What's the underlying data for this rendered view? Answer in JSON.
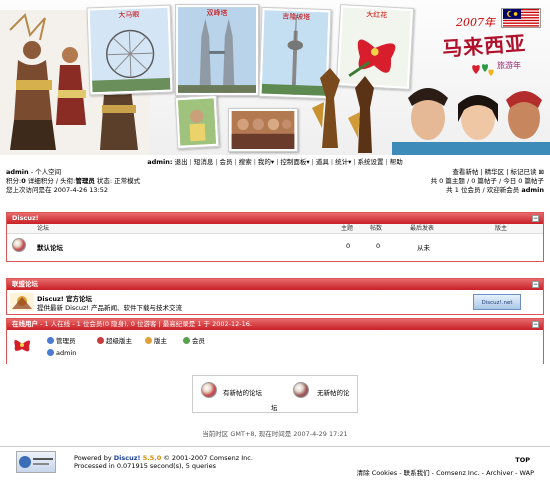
{
  "banner": {
    "photo_captions": [
      "大马眼",
      "双峰塔",
      "吉隆坡塔",
      "大红花"
    ],
    "logo_year": "2007年",
    "logo_title": "马来西亚",
    "logo_sub": "旅游年"
  },
  "nav": {
    "user": "admin:",
    "items": [
      "退出",
      "短消息",
      "会员",
      "搜索",
      "我的▾",
      "控制面板▾",
      "道具",
      "统计▾",
      "系统设置",
      "帮助"
    ]
  },
  "userinfo": {
    "line1_user": "admin",
    "line1_rest": " - 个人空间",
    "line2_a": "积分:",
    "line2_points": "0",
    "line2_b": " 详细积分 / 头衔:",
    "line2_title": "管理员",
    "line2_c": " 状态: 正常模式",
    "line3": "您上次访问是在 2007-4-26 13:52"
  },
  "rightinfo": {
    "line1": "查看新帖 | 精华区 | 标记已读 ⊠",
    "line2": "共 0 篇主题 / 0 篇帖子 / 今日 0 篇帖子",
    "line3_a": "共 1 位会员 / 欢迎新会员 ",
    "line3_user": "admin"
  },
  "discuz_section": {
    "title": "Discuz!",
    "toggle": "−",
    "col_forum": "论坛",
    "col_topics": "主题",
    "col_posts": "帖数",
    "col_last": "最后发表",
    "col_mod": "版主",
    "forum_name": "默认论坛",
    "topics": "0",
    "posts": "0",
    "last": "从未"
  },
  "links_section": {
    "title": "联盟论坛",
    "toggle": "−",
    "name": "Discuz! 官方论坛",
    "desc": "提供最新 Discuz! 产品新闻、软件下载与技术交流",
    "badge": "Discuz!.net"
  },
  "online_section": {
    "title": "在线用户",
    "summary": " - 1 人在线 - 1 位会员(0 隐身), 0 位游客 | 最高纪录是 1 于 2002-12-16.",
    "toggle": "−",
    "legend": [
      "管理员",
      "超级版主",
      "版主",
      "会员"
    ],
    "online_user": "admin"
  },
  "status_box": {
    "new_label": "有新帖的论坛",
    "no_new_label": "无新帖的论",
    "no_new_label_wrap": "坛"
  },
  "timeline": "当前时区 GMT+8, 现在时间是 2007-4-29 17:21",
  "footer": {
    "powered_a": "Powered by ",
    "powered_brand": "Discuz!",
    "powered_version": " 5.5.0",
    "powered_b": " © 2001-2007 Comsenz Inc.",
    "processed": "Processed in 0.071915 second(s), 5 queries",
    "top": "TOP",
    "links": "清除 Cookies - 联系我们 - Comsenz Inc. - Archiver - WAP"
  }
}
